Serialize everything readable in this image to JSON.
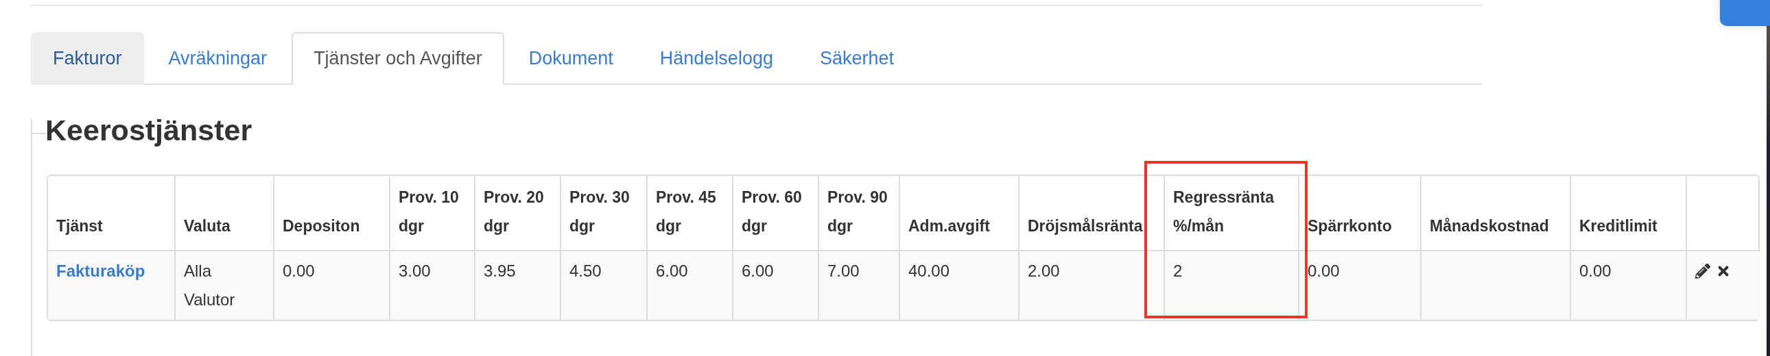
{
  "tabs": [
    {
      "label": "Fakturor",
      "selected": false,
      "hovered": true
    },
    {
      "label": "Avräkningar",
      "selected": false,
      "hovered": false
    },
    {
      "label": "Tjänster och Avgifter",
      "selected": true,
      "hovered": false
    },
    {
      "label": "Dokument",
      "selected": false,
      "hovered": false
    },
    {
      "label": "Händelselogg",
      "selected": false,
      "hovered": false
    },
    {
      "label": "Säkerhet",
      "selected": false,
      "hovered": false
    }
  ],
  "section": {
    "title": "Keerostjänster"
  },
  "table": {
    "columns": [
      {
        "label": "Tjänst",
        "highlighted": false
      },
      {
        "label": "Valuta",
        "highlighted": false
      },
      {
        "label": "Depositon",
        "highlighted": false
      },
      {
        "label": "Prov. 10 dgr",
        "highlighted": false
      },
      {
        "label": "Prov. 20 dgr",
        "highlighted": false
      },
      {
        "label": "Prov. 30 dgr",
        "highlighted": false
      },
      {
        "label": "Prov. 45 dgr",
        "highlighted": false
      },
      {
        "label": "Prov. 60 dgr",
        "highlighted": false
      },
      {
        "label": "Prov. 90 dgr",
        "highlighted": false
      },
      {
        "label": "Adm.avgift",
        "highlighted": false
      },
      {
        "label": "Dröjsmålsränta",
        "highlighted": false
      },
      {
        "label": "Regressränta %/mån",
        "highlighted": true
      },
      {
        "label": "Spärrkonto",
        "highlighted": false
      },
      {
        "label": "Månadskostnad",
        "highlighted": false
      },
      {
        "label": "Kreditlimit",
        "highlighted": false
      }
    ],
    "rows": [
      {
        "cells": [
          "Fakturaköp",
          "Alla Valutor",
          "0.00",
          "3.00",
          "3.95",
          "4.50",
          "6.00",
          "6.00",
          "7.00",
          "40.00",
          "2.00",
          "2",
          "0.00",
          "",
          "0.00"
        ]
      }
    ]
  }
}
